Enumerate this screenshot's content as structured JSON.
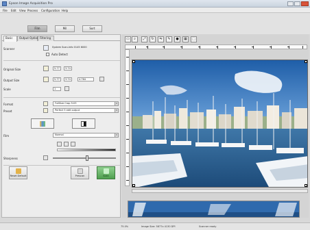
{
  "window": {
    "title": "Epson Image Acquisition Pro"
  },
  "menu": [
    "File",
    "Edit",
    "View",
    "Process",
    "Configuration",
    "Help"
  ],
  "modes": [
    {
      "label": "Film",
      "active": true
    },
    {
      "label": "Mil",
      "active": false
    },
    {
      "label": "Sort",
      "active": false
    }
  ],
  "tabs": [
    "Basic",
    "Output Options",
    "Filtering"
  ],
  "settings": {
    "scanner_label": "Scanner",
    "scanner_value": "System Scan-Info 0145 6000",
    "auto_detect_label": "Auto Detect",
    "original_size_label": "Original Size",
    "original_w": "5.77",
    "original_h": "3.74",
    "output_size_label": "Output Size",
    "output_w": "5.77",
    "output_h": "3.74",
    "output_dpi": "4.764",
    "scale_label": "Scale",
    "scale_value": "1",
    "format_label": "Format",
    "format_value": "FullSize Crop 5:03",
    "preset_label": "Preset",
    "preset_value": "Perfect 5 edit output",
    "film_label": "Film",
    "film_value": "Normal",
    "sharpness_label": "Sharpness"
  },
  "actions": {
    "reset_label": "Reset Default",
    "preview_label": "Prescan",
    "scan_label": "Scan"
  },
  "status": {
    "zoom": "75.0%",
    "image_size": "Image Size: 5877x 4130 DPI",
    "scanner_state": "Scanner ready"
  },
  "colors": {
    "scan_button": "#5fae5f",
    "title_bar": "#c9d3de"
  }
}
